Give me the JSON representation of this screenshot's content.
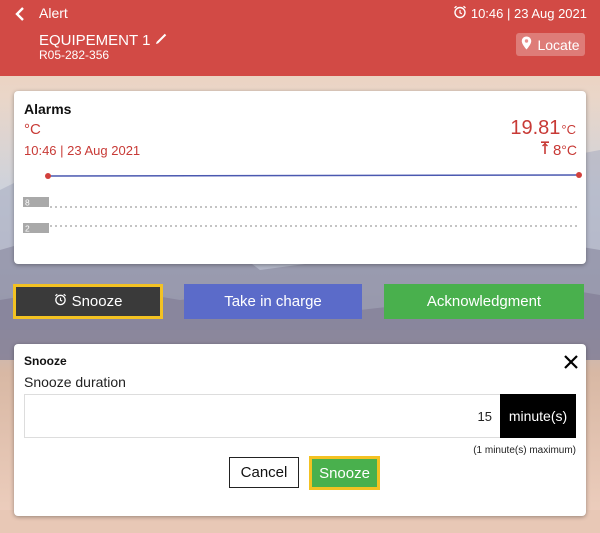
{
  "header": {
    "title": "Alert",
    "time": "10:46 | 23 Aug 2021",
    "equipment_name": "EQUIPEMENT 1",
    "equipment_ref": "R05-282-356",
    "locate_label": "Locate"
  },
  "alarms": {
    "title": "Alarms",
    "unit": "°C",
    "timestamp": "10:46 | 23 Aug 2021",
    "current_value": "19.81",
    "current_unit": "°C",
    "threshold_value": "8",
    "threshold_unit": "°C",
    "threshold_lines": [
      "8",
      "2"
    ]
  },
  "actions": {
    "snooze": "Snooze",
    "take_in_charge": "Take in charge",
    "acknowledgment": "Acknowledgment"
  },
  "snooze_panel": {
    "title": "Snooze",
    "duration_label": "Snooze duration",
    "duration_value": "15",
    "unit_label": "minute(s)",
    "max_note": "(1 minute(s) maximum)",
    "cancel": "Cancel",
    "confirm": "Snooze"
  },
  "colors": {
    "header": "#d24a45",
    "accent_red": "#c83a36",
    "take_in_charge": "#5b6bc9",
    "acknowledgment": "#49b04d",
    "highlight": "#f3c222"
  }
}
